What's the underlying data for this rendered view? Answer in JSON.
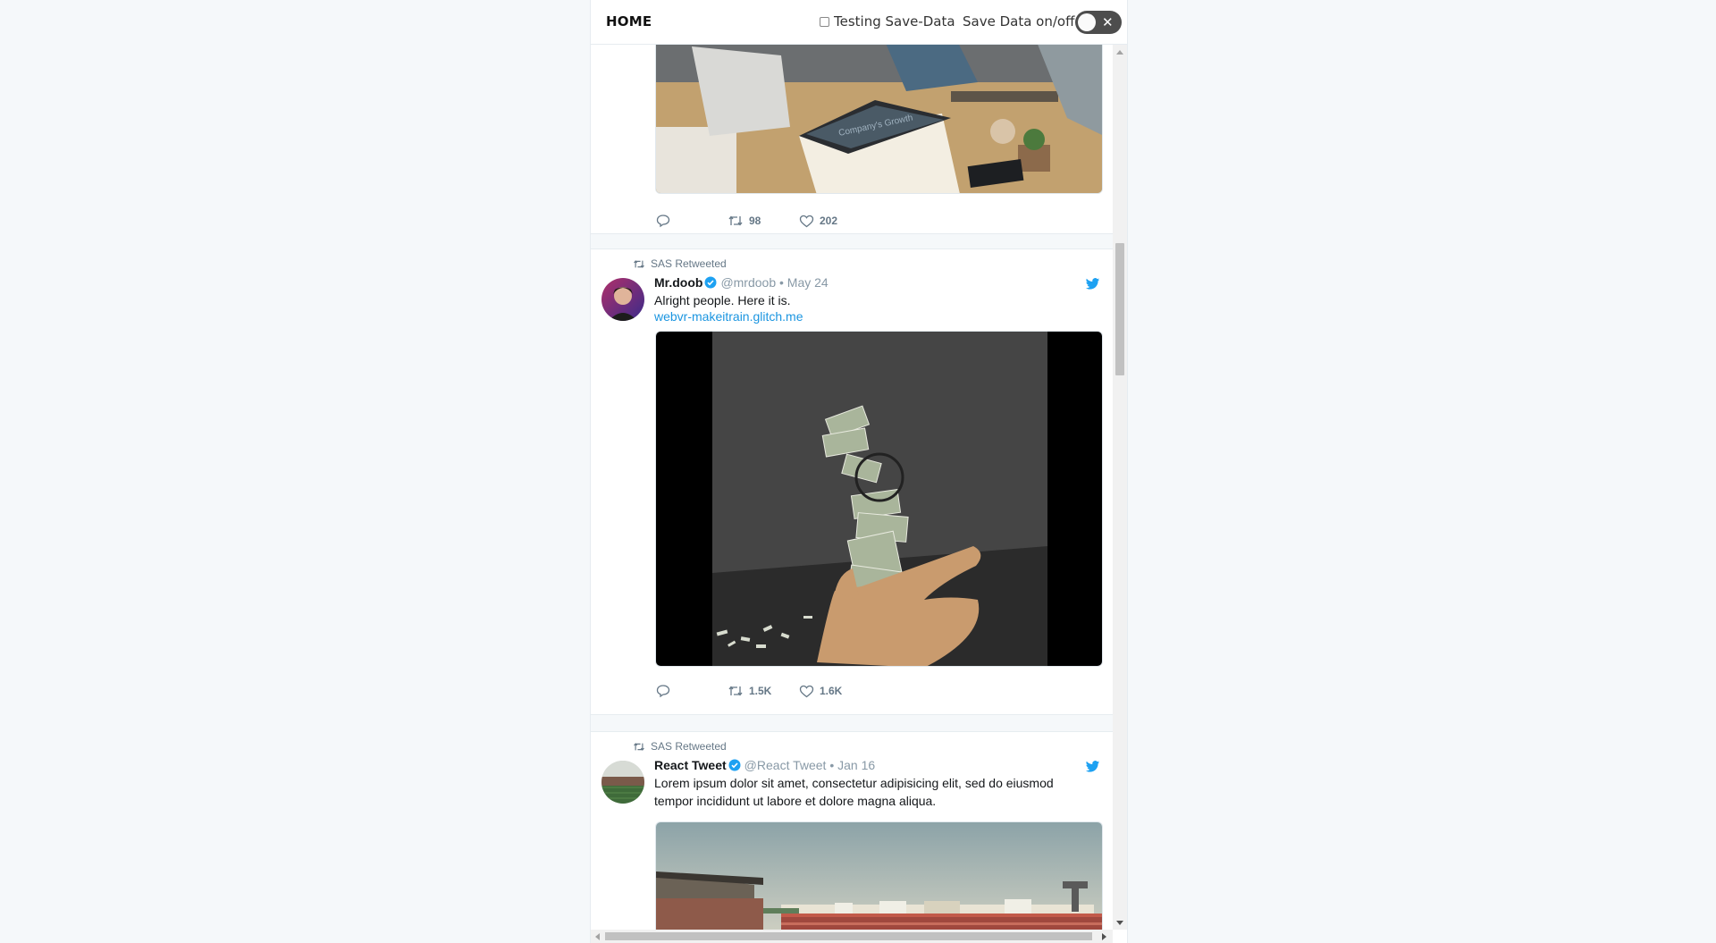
{
  "header": {
    "title": "HOME",
    "test_label": "Testing Save-Data",
    "save_label": "Save Data on/off",
    "toggle_off_glyph": "✕"
  },
  "tweets": [
    {
      "reply_count": "",
      "retweet_count": "98",
      "like_count": "202"
    },
    {
      "retweeted_by": "SAS Retweeted",
      "name": "Mr.doob",
      "handle_date": "@mrdoob • May 24",
      "text": "Alright people. Here it is.",
      "link": "webvr-makeitrain.glitch.me",
      "retweet_count": "1.5K",
      "like_count": "1.6K"
    },
    {
      "retweeted_by": "SAS Retweeted",
      "name": "React Tweet",
      "handle_date": "@React Tweet • Jan 16",
      "text": "Lorem ipsum dolor sit amet, consectetur adipisicing elit, sed do eiusmod tempor incididunt ut labore et dolore magna aliqua."
    }
  ],
  "images": {
    "tweet1_media_text": "Company's Growth"
  },
  "icons": {
    "reply": "reply-icon",
    "retweet": "retweet-icon",
    "like": "heart-icon",
    "verified": "verified-badge-icon",
    "bird": "twitter-bird-icon"
  },
  "colors": {
    "link": "#1b95e0",
    "verified": "#1da1f2",
    "muted": "#657786",
    "toggle": "#4d4d4d"
  }
}
